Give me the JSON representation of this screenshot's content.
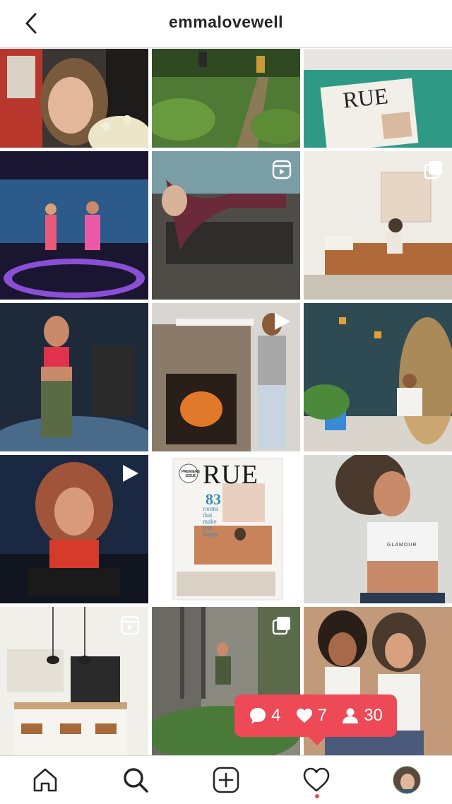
{
  "header": {
    "title": "emmalovewell",
    "back_icon": "chevron-left-icon"
  },
  "grid": {
    "tiles": [
      {
        "name": "post-selfie-flowers",
        "badge": null
      },
      {
        "name": "post-hiking-trail",
        "badge": null
      },
      {
        "name": "post-rue-magazine-jacket",
        "badge": null
      },
      {
        "name": "post-studio-duo",
        "badge": null
      },
      {
        "name": "post-plank-exercise",
        "badge": "reels-icon"
      },
      {
        "name": "post-living-room-sofa",
        "badge": "carousel-icon"
      },
      {
        "name": "post-mirror-selfie",
        "badge": null
      },
      {
        "name": "post-fireplace",
        "badge": "play-icon"
      },
      {
        "name": "post-plant-wall",
        "badge": null
      },
      {
        "name": "post-workout-bike",
        "badge": "play-icon"
      },
      {
        "name": "post-rue-cover",
        "badge": null,
        "cover": {
          "logo": "RUE",
          "eyebrow": "PREMIERE ISSUE",
          "big_number": "83",
          "headline_lines": [
            "rooms",
            "that",
            "make",
            "you",
            "happy"
          ]
        }
      },
      {
        "name": "post-sports-portrait",
        "badge": null,
        "bra_text": "GLAMOUR"
      },
      {
        "name": "post-kitchen-island",
        "badge": "reels-icon"
      },
      {
        "name": "post-garden-ladder",
        "badge": "carousel-icon"
      },
      {
        "name": "post-duo-portrait",
        "badge": null
      }
    ]
  },
  "notifications": {
    "comments": "4",
    "likes": "7",
    "follows": "30"
  },
  "tabbar": {
    "items": [
      "home-icon",
      "search-icon",
      "new-post-icon",
      "activity-heart-icon",
      "profile-avatar"
    ]
  },
  "colors": {
    "accent": "#ed4956",
    "text": "#262626",
    "divider": "#dbdbdb"
  }
}
